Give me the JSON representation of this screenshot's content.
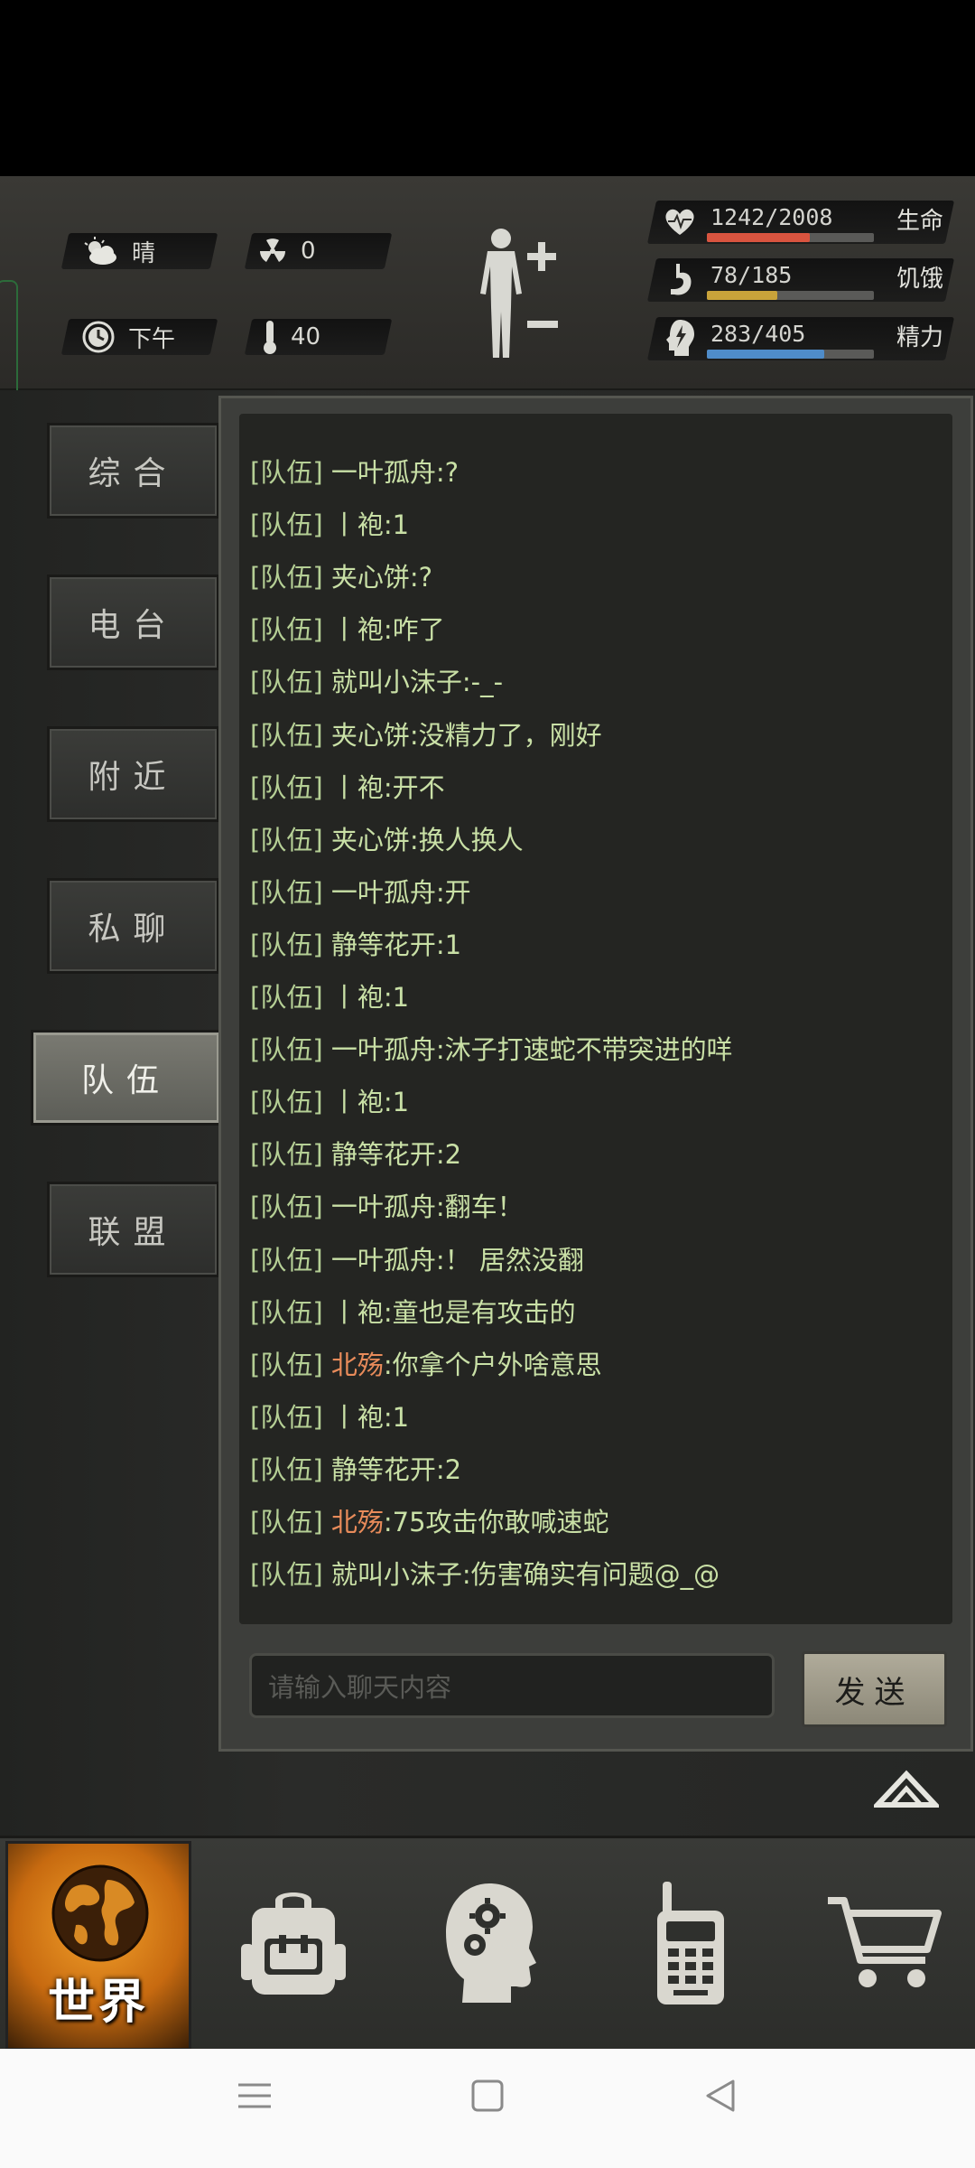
{
  "weather": {
    "icon": "cloud-sun-icon",
    "text": "晴"
  },
  "radiation": {
    "icon": "radiation-icon",
    "value": "0"
  },
  "time": {
    "icon": "clock-icon",
    "text": "下午"
  },
  "temperature": {
    "icon": "thermometer-icon",
    "value": "40"
  },
  "stats": {
    "health": {
      "text": "1242/2008",
      "label": "生命",
      "fraction": 0.618,
      "color": "#d9543f"
    },
    "hunger": {
      "text": "78/185",
      "label": "饥饿",
      "fraction": 0.42,
      "color": "#c9a33a"
    },
    "energy": {
      "text": "283/405",
      "label": "精力",
      "fraction": 0.7,
      "color": "#4f8cc9"
    }
  },
  "tabs": [
    "综合",
    "电台",
    "附近",
    "私聊",
    "队伍",
    "联盟"
  ],
  "active_tab": "队伍",
  "messages": [
    {
      "tag": "[队伍]",
      "name": "一叶孤舟",
      "text": ":?"
    },
    {
      "tag": "[队伍]",
      "name": "丨袍",
      "text": ":1"
    },
    {
      "tag": "[队伍]",
      "name": "夹心饼",
      "text": ":?"
    },
    {
      "tag": "[队伍]",
      "name": "丨袍",
      "text": ":咋了"
    },
    {
      "tag": "[队伍]",
      "name": "就叫小沫子",
      "text": ":-_-"
    },
    {
      "tag": "[队伍]",
      "name": "夹心饼",
      "text": ":没精力了，刚好"
    },
    {
      "tag": "[队伍]",
      "name": "丨袍",
      "text": ":开不"
    },
    {
      "tag": "[队伍]",
      "name": "夹心饼",
      "text": ":换人换人"
    },
    {
      "tag": "[队伍]",
      "name": "一叶孤舟",
      "text": ":开"
    },
    {
      "tag": "[队伍]",
      "name": "静等花开",
      "text": ":1"
    },
    {
      "tag": "[队伍]",
      "name": "丨袍",
      "text": ":1"
    },
    {
      "tag": "[队伍]",
      "name": "一叶孤舟",
      "text": ":沐子打速蛇不带突进的咩"
    },
    {
      "tag": "[队伍]",
      "name": "丨袍",
      "text": ":1"
    },
    {
      "tag": "[队伍]",
      "name": "静等花开",
      "text": ":2"
    },
    {
      "tag": "[队伍]",
      "name": "一叶孤舟",
      "text": ":翻车！"
    },
    {
      "tag": "[队伍]",
      "name": "一叶孤舟",
      "text": ":！ 居然没翻"
    },
    {
      "tag": "[队伍]",
      "name": "丨袍",
      "text": ":童也是有攻击的"
    },
    {
      "tag": "[队伍]",
      "name": "北殇",
      "text": ":你拿个户外啥意思"
    },
    {
      "tag": "[队伍]",
      "name": "丨袍",
      "text": ":1"
    },
    {
      "tag": "[队伍]",
      "name": "静等花开",
      "text": ":2"
    },
    {
      "tag": "[队伍]",
      "name": "北殇",
      "text": ":75攻击你敢喊速蛇"
    },
    {
      "tag": "[队伍]",
      "name": "就叫小沫子",
      "text": ":伤害确实有问题@_@"
    }
  ],
  "chat_input": {
    "placeholder": "请输入聊天内容"
  },
  "send_label": "发送",
  "bottom_nav": [
    {
      "icon": "globe-icon",
      "label": "世界"
    },
    {
      "icon": "backpack-icon",
      "label": ""
    },
    {
      "icon": "brain-gears-icon",
      "label": ""
    },
    {
      "icon": "walkie-talkie-icon",
      "label": ""
    },
    {
      "icon": "shopping-cart-icon",
      "label": ""
    }
  ]
}
